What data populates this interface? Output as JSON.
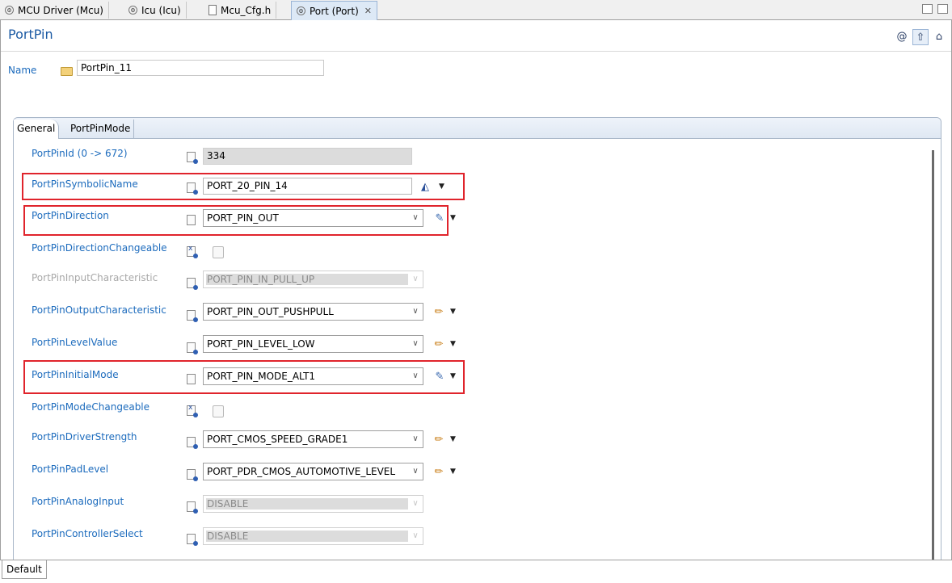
{
  "editor_tabs": [
    {
      "label": "MCU Driver (Mcu)",
      "icon": "gear-icon",
      "active": false
    },
    {
      "label": "Icu (Icu)",
      "icon": "gear-icon",
      "active": false
    },
    {
      "label": "Mcu_Cfg.h",
      "icon": "file-icon",
      "active": false
    },
    {
      "label": "Port (Port)",
      "icon": "gear-icon",
      "active": true
    }
  ],
  "header": {
    "title": "PortPin",
    "icons": [
      "at-icon",
      "up-arrow-icon",
      "home-icon"
    ]
  },
  "name_field": {
    "label": "Name",
    "value": "PortPin_11"
  },
  "inner_tabs": [
    "General",
    "PortPinMode"
  ],
  "bottom_tab": "Default",
  "highlight_color": "#e0242c",
  "rows": [
    {
      "label": "PortPinId (0 -> 672)",
      "kind": "readonly-text",
      "value": "334"
    },
    {
      "label": "PortPinSymbolicName",
      "kind": "text",
      "value": "PORT_20_PIN_14",
      "action": "calculate-icon",
      "highlighted": true
    },
    {
      "label": "PortPinDirection",
      "kind": "combo",
      "value": "PORT_PIN_OUT",
      "action": "wand-icon",
      "highlighted": true
    },
    {
      "label": "PortPinDirectionChangeable",
      "kind": "checkbox",
      "checked": false
    },
    {
      "label": "PortPinInputCharacteristic",
      "kind": "combo-disabled",
      "value": "PORT_PIN_IN_PULL_UP"
    },
    {
      "label": "PortPinOutputCharacteristic",
      "kind": "combo",
      "value": "PORT_PIN_OUT_PUSHPULL",
      "action": "pencil-icon"
    },
    {
      "label": "PortPinLevelValue",
      "kind": "combo",
      "value": "PORT_PIN_LEVEL_LOW",
      "action": "pencil-icon"
    },
    {
      "label": "PortPinInitialMode",
      "kind": "combo",
      "value": "PORT_PIN_MODE_ALT1",
      "action": "wand-icon",
      "highlighted": true
    },
    {
      "label": "PortPinModeChangeable",
      "kind": "checkbox",
      "checked": false
    },
    {
      "label": "PortPinDriverStrength",
      "kind": "combo",
      "value": "PORT_CMOS_SPEED_GRADE1",
      "action": "pencil-icon"
    },
    {
      "label": "PortPinPadLevel",
      "kind": "combo",
      "value": "PORT_PDR_CMOS_AUTOMOTIVE_LEVEL",
      "action": "pencil-icon"
    },
    {
      "label": "PortPinAnalogInput",
      "kind": "combo-disabled",
      "value": "DISABLE"
    },
    {
      "label": "PortPinControllerSelect",
      "kind": "combo-disabled",
      "value": "DISABLE"
    }
  ]
}
